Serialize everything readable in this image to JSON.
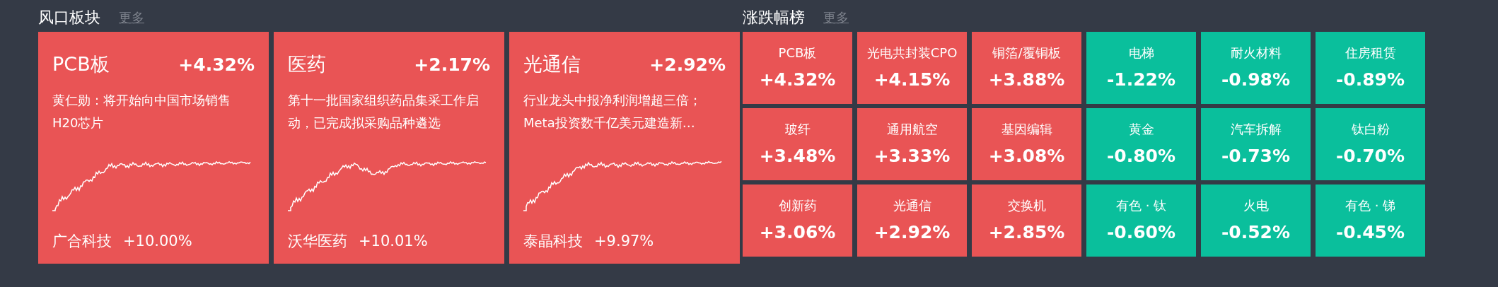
{
  "hot_sectors": {
    "title": "风口板块",
    "more": "更多",
    "cards": [
      {
        "name": "PCB板",
        "change": "+4.32%",
        "news": "黄仁勋：将开始向中国市场销售H20芯片",
        "leader": "广合科技",
        "leader_change": "+10.00%"
      },
      {
        "name": "医药",
        "change": "+2.17%",
        "news": "第十一批国家组织药品集采工作启动，已完成拟采购品种遴选",
        "leader": "沃华医药",
        "leader_change": "+10.01%"
      },
      {
        "name": "光通信",
        "change": "+2.92%",
        "news": "行业龙头中报净利润增超三倍；Meta投资数千亿美元建造新…",
        "leader": "泰晶科技",
        "leader_change": "+9.97%"
      }
    ]
  },
  "rankings": {
    "title": "涨跌幅榜",
    "more": "更多",
    "tiles": [
      {
        "name": "PCB板",
        "change": "+4.32%",
        "kind": "up"
      },
      {
        "name": "光电共封装CPO",
        "change": "+4.15%",
        "kind": "up"
      },
      {
        "name": "铜箔/覆铜板",
        "change": "+3.88%",
        "kind": "up"
      },
      {
        "name": "电梯",
        "change": "-1.22%",
        "kind": "down"
      },
      {
        "name": "耐火材料",
        "change": "-0.98%",
        "kind": "down"
      },
      {
        "name": "住房租赁",
        "change": "-0.89%",
        "kind": "down"
      },
      {
        "name": "玻纤",
        "change": "+3.48%",
        "kind": "up"
      },
      {
        "name": "通用航空",
        "change": "+3.33%",
        "kind": "up"
      },
      {
        "name": "基因编辑",
        "change": "+3.08%",
        "kind": "up"
      },
      {
        "name": "黄金",
        "change": "-0.80%",
        "kind": "down"
      },
      {
        "name": "汽车拆解",
        "change": "-0.73%",
        "kind": "down"
      },
      {
        "name": "钛白粉",
        "change": "-0.70%",
        "kind": "down"
      },
      {
        "name": "创新药",
        "change": "+3.06%",
        "kind": "up"
      },
      {
        "name": "光通信",
        "change": "+2.92%",
        "kind": "up"
      },
      {
        "name": "交换机",
        "change": "+2.85%",
        "kind": "up"
      },
      {
        "name": "有色 · 钛",
        "change": "-0.60%",
        "kind": "down"
      },
      {
        "name": "火电",
        "change": "-0.52%",
        "kind": "down"
      },
      {
        "name": "有色 · 锑",
        "change": "-0.45%",
        "kind": "down"
      }
    ]
  }
}
